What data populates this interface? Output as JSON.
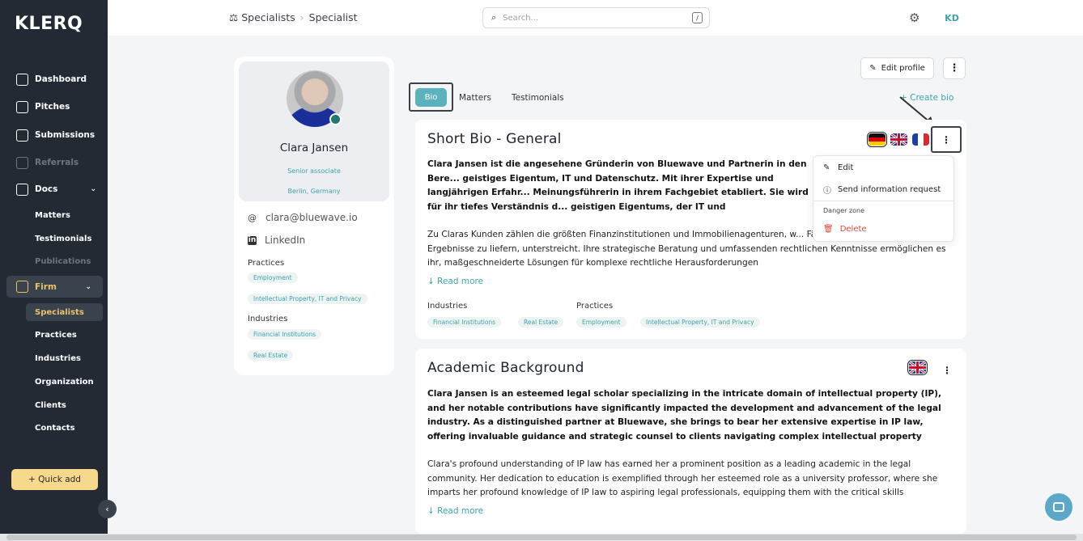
{
  "app": {
    "logo": "KLERQ"
  },
  "sidebar": {
    "items": [
      {
        "label": "Dashboard"
      },
      {
        "label": "Pitches"
      },
      {
        "label": "Submissions"
      },
      {
        "label": "Referrals"
      },
      {
        "label": "Docs"
      }
    ],
    "docs_sub": [
      "Matters",
      "Testimonials",
      "Publications"
    ],
    "firm_label": "Firm",
    "firm_sub": [
      "Specialists",
      "Practices",
      "Industries",
      "Organization",
      "Clients",
      "Contacts"
    ],
    "quick_add": "+ Quick add",
    "collapse_icon": "‹"
  },
  "header": {
    "breadcrumb": [
      "Specialists",
      "Specialist"
    ],
    "search_placeholder": "Search...",
    "search_shortcut": "/",
    "user_initials": "KD"
  },
  "profile": {
    "name": "Clara Jansen",
    "role": "Senior associate",
    "location": "Berlin, Germany",
    "email": "clara@bluewave.io",
    "linkedin": "LinkedIn",
    "practices_label": "Practices",
    "practices": [
      "Employment",
      "Intellectual Property, IT and Privacy"
    ],
    "industries_label": "Industries",
    "industries": [
      "Financial Institutions",
      "Real Estate"
    ]
  },
  "tabs": [
    "Bio",
    "Matters",
    "Testimonials"
  ],
  "actions": {
    "edit_profile": "Edit profile",
    "create_bio": "+ Create bio"
  },
  "bio_cards": [
    {
      "title": "Short Bio - General",
      "bold_text": "Clara Jansen ist die angesehene Gründerin von Bluewave und Partnerin in den Bere... geistiges Eigentum, IT und Datenschutz. Mit ihrer Expertise und langjährigen Erfahr... Meinungsführerin in ihrem Fachgebiet etabliert. Sie wird für ihr tiefes Verständnis d... geistigen Eigentums, der IT und Datenschutzfragen hoch geschätzt.",
      "body_text": "Zu Claras Kunden zählen die größten Finanzinstitutionen und Immobilienagenturen, w... Fähigkeit, außergewöhnliche Ergebnisse zu liefern, unterstreicht. Ihre strategische Beratung und umfassenden rechtlichen Kenntnisse ermöglichen es ihr, maßgeschneiderte Lösungen für komplexe rechtliche Herausforderungen",
      "read_more": "↓ Read more",
      "industries_label": "Industries",
      "industries": [
        "Financial Institutions",
        "Real Estate"
      ],
      "practices_label": "Practices",
      "practices": [
        "Employment",
        "Intellectual Property, IT and Privacy"
      ]
    },
    {
      "title": "Academic Background",
      "bold_text": "Clara Jansen is an esteemed legal scholar specializing in the intricate domain of intellectual property (IP), and her notable contributions have significantly impacted the development and advancement of the legal industry. As a distinguished partner at Bluewave, she brings to bear her extensive expertise in IP law, offering invaluable guidance and strategic counsel to clients navigating complex intellectual property matters.",
      "body_text": "Clara's profound understanding of IP law has earned her a prominent position as a leading academic in the legal community. Her dedication to education is exemplified through her esteemed role as a university professor, where she imparts her profound knowledge of IP law to aspiring legal professionals, equipping them with the critical skills",
      "read_more": "↓ Read more"
    }
  ],
  "context_menu": {
    "edit": "Edit",
    "send_request": "Send information request",
    "danger_label": "Danger zone",
    "delete": "Delete"
  },
  "icons": [
    "home-icon",
    "presentation-icon",
    "document-icon",
    "chat-icon",
    "folder-icon",
    "bank-icon",
    "gear-icon",
    "search-icon",
    "camera-icon",
    "at-icon",
    "linkedin-icon",
    "edit-icon",
    "kebab-icon",
    "info-icon",
    "trash-icon",
    "arrow-down-icon",
    "chat-bubble-icon"
  ],
  "colors": {
    "accent": "#5bb2bc",
    "sidebar": "#232a33",
    "active": "#e9c26c",
    "danger": "#e0463a",
    "quick_add": "#f7d98b"
  }
}
